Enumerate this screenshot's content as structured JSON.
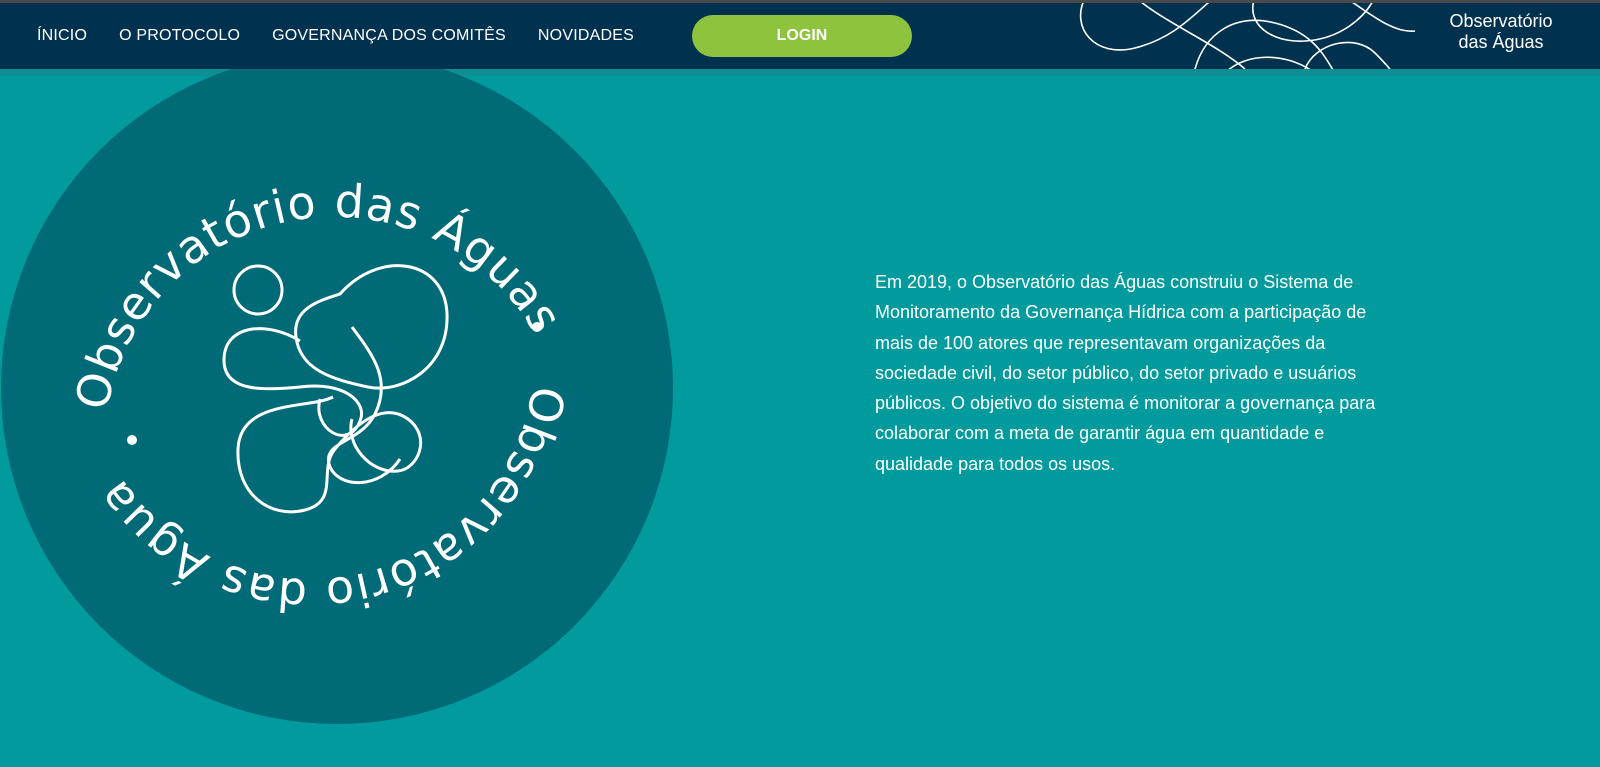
{
  "nav": {
    "items": [
      {
        "label": "ÍNICIO"
      },
      {
        "label": "O PROTOCOLO"
      },
      {
        "label": "GOVERNANÇA DOS COMITÊS"
      },
      {
        "label": "NOVIDADES"
      }
    ],
    "login_label": "LOGIN"
  },
  "brand": {
    "line1": "Observatório",
    "line2": "das Águas"
  },
  "seal": {
    "text_top": "Observatório das Águas",
    "text_bottom": "Observatório das Águas"
  },
  "intro": {
    "text": "Em 2019, o Observatório das Águas construiu o Sistema de Monitoramento da Governança Hídrica com a participação de mais de 100 atores que representavam organizações da sociedade civil, do setor público, do setor privado e usuários públicos. O objetivo do sistema é monitorar a governança para colaborar com a meta de garantir água em quantidade e qualidade para todos os usos."
  },
  "colors": {
    "navbar": "#00324f",
    "page_background": "#019a9d",
    "circle": "#006a77",
    "login_button": "#8dc33d",
    "text": "#ffffff"
  },
  "icons": {
    "seal_logo": "water-droplets-logo-icon",
    "nav_decoration": "wavy-lines-decoration"
  }
}
